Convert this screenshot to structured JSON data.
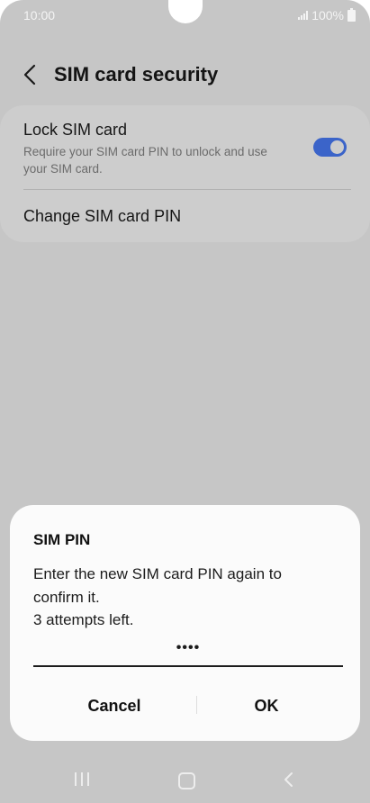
{
  "status_bar": {
    "time": "10:00",
    "battery_text": "100%"
  },
  "header": {
    "title": "SIM card security",
    "back_icon": "chevron-left-icon"
  },
  "settings": {
    "lock_sim": {
      "title": "Lock SIM card",
      "description": "Require your SIM card PIN to unlock and use your SIM card.",
      "enabled": true
    },
    "change_pin": {
      "title": "Change SIM card PIN"
    }
  },
  "dialog": {
    "title": "SIM PIN",
    "message_lines": [
      "Enter the new SIM card PIN again to",
      "confirm it.",
      "3 attempts left."
    ],
    "pin_masked": "••••",
    "cancel_label": "Cancel",
    "ok_label": "OK"
  },
  "colors": {
    "accent": "#3b64c9",
    "scrim": "#c6c6c6",
    "dialog_bg": "#fbfbfb"
  },
  "nav_bar": {
    "recents_icon": "recents-icon",
    "home_icon": "home-icon",
    "back_icon": "back-icon"
  }
}
